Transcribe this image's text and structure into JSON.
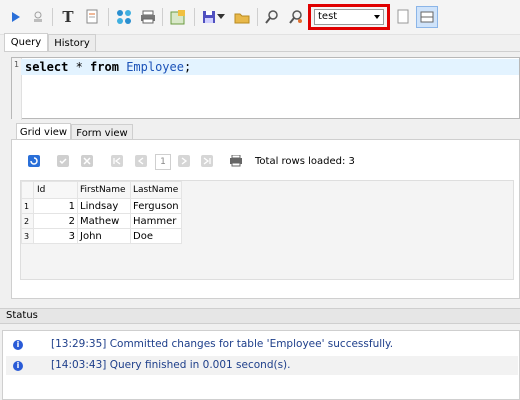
{
  "toolbar": {
    "database_select": "test",
    "buttons": [
      "run-icon",
      "stop-icon",
      "format-text-icon",
      "new-doc-icon",
      "connect-icon",
      "print-icon",
      "import-icon",
      "save-icon",
      "save-dropdown-icon",
      "open-folder-icon",
      "find-icon",
      "replace-icon",
      "new-file-icon",
      "layout-icon"
    ]
  },
  "editor_tabs": [
    "Query",
    "History"
  ],
  "editor": {
    "line_number": "1",
    "kw1": "select",
    "star": " * ",
    "kw2": "from",
    "table": "Employee",
    "semicolon": ";"
  },
  "result_tabs": [
    "Grid view",
    "Form view"
  ],
  "navigator": {
    "page": "1",
    "rows_loaded": "Total rows loaded: 3"
  },
  "grid": {
    "columns": [
      "Id",
      "FirstName",
      "LastName"
    ],
    "rows": [
      {
        "num": "1",
        "id": "1",
        "first": "Lindsay",
        "last": "Ferguson"
      },
      {
        "num": "2",
        "id": "2",
        "first": "Mathew",
        "last": "Hammer"
      },
      {
        "num": "3",
        "id": "3",
        "first": "John",
        "last": "Doe"
      }
    ]
  },
  "status": {
    "label": "Status",
    "messages": [
      {
        "time": "[13:29:35]",
        "text": "Committed changes for table 'Employee' successfully."
      },
      {
        "time": "[14:03:43]",
        "text": "Query finished in 0.001 second(s)."
      }
    ]
  },
  "colors": {
    "highlight": "#e00000",
    "keyword_table": "#1b52b8",
    "status_text": "#1d3e8a"
  }
}
